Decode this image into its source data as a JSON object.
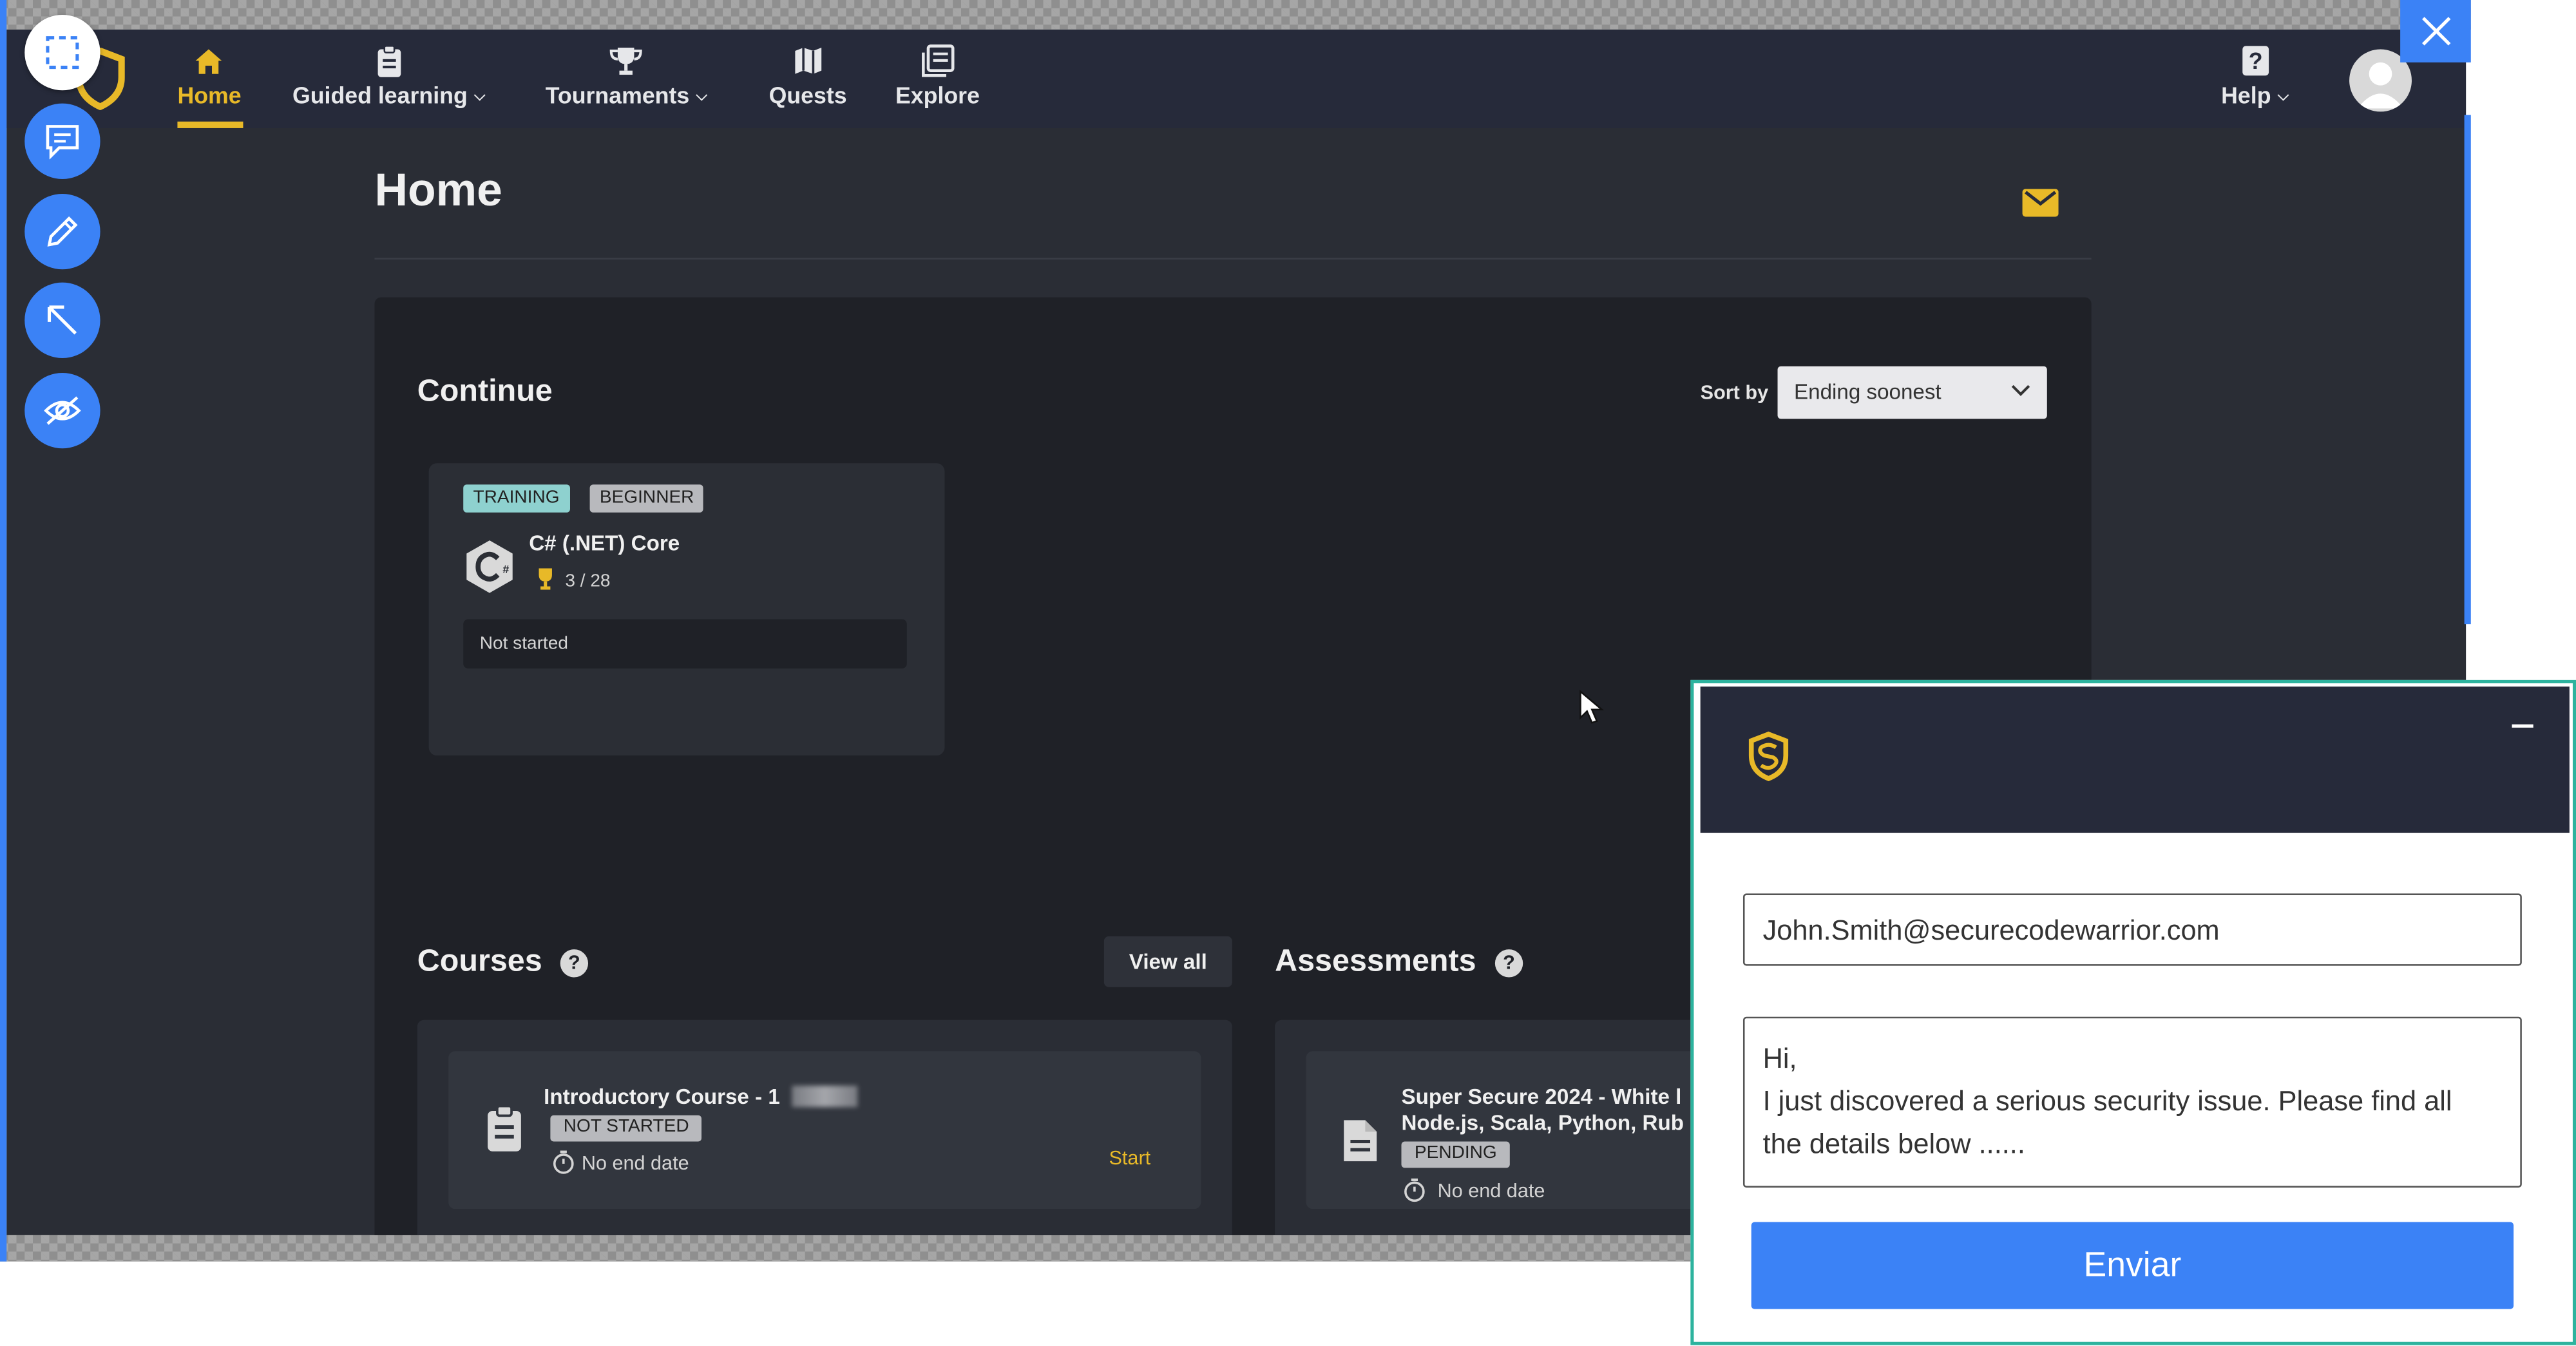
{
  "nav": {
    "items": [
      {
        "label": "Home",
        "icon": "home-icon",
        "active": true
      },
      {
        "label": "Guided learning",
        "icon": "clipboard-icon",
        "dropdown": true
      },
      {
        "label": "Tournaments",
        "icon": "trophy-icon",
        "dropdown": true
      },
      {
        "label": "Quests",
        "icon": "map-icon"
      },
      {
        "label": "Explore",
        "icon": "library-icon"
      }
    ],
    "help": {
      "label": "Help",
      "icon": "question-icon"
    }
  },
  "page": {
    "title": "Home"
  },
  "continue": {
    "heading": "Continue",
    "sort_label": "Sort by",
    "sort_value": "Ending soonest",
    "card": {
      "tags": [
        "TRAINING",
        "BEGINNER"
      ],
      "title": "C# (.NET) Core",
      "progress": "3 / 28",
      "status": "Not started"
    }
  },
  "courses": {
    "heading": "Courses",
    "view_all": "View all",
    "item": {
      "title": "Introductory Course - 1",
      "badge": "NOT STARTED",
      "due": "No end date",
      "action": "Start"
    }
  },
  "assessments": {
    "heading": "Assessments",
    "item": {
      "title_line1": "Super Secure 2024 - White l",
      "title_line2": "Node.js, Scala, Python, Rub",
      "badge": "PENDING",
      "due": "No end date"
    }
  },
  "feedback": {
    "email": "John.Smith@securecodewarrior.com",
    "message_lines": [
      "Hi,",
      "I just discovered a serious security issue. Please find all",
      "the details below ......"
    ],
    "send_label": "Enviar"
  },
  "colors": {
    "accent": "#e8b928",
    "tool_blue": "#3b82f6",
    "nav_bg": "#262a3a",
    "widget_border": "#2db39e"
  }
}
